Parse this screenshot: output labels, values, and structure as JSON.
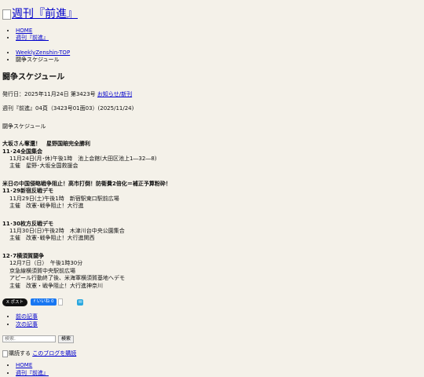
{
  "site": {
    "logo_text": "週刊『前進』"
  },
  "nav": {
    "items": [
      "HOME",
      "週刊『前進』"
    ]
  },
  "breadcrumb": {
    "link": "WeeklyZenshin-TOP",
    "current": "闘争スケジュール"
  },
  "article": {
    "title": "闘争スケジュール",
    "meta_prefix": "発行日：2025年11月24日 第3423号",
    "meta_link": "お知らせ/新刊",
    "issue_line": "週刊『前進』04頁（3423号01面03）(2025/11/24)",
    "section": "闘争スケジュール",
    "events": [
      {
        "head": [
          "大坂さん奪還！　星野国賠完全勝利",
          "11･24全国集会"
        ],
        "lines": [
          "11月24日(月･休)午後1時　池上会館(大田区池上1―32―8)",
          "主催　星野･大坂全国救援会"
        ]
      },
      {
        "head": [
          "米日の中国侵略戦争阻止！高市打倒！防衛費2倍化＝補正予算粉砕！",
          "11･29新宿反戦デモ"
        ],
        "lines": [
          "11月29日(土)午後1時　新宿駅東口駅前広場",
          "主催　改憲･戦争阻止！大行進"
        ]
      },
      {
        "head": [
          "11･30枚方反戦デモ"
        ],
        "lines": [
          "11月30日(日)午後2時　木津川台中央公園集合",
          "主催　改憲･戦争阻止！大行進関西"
        ]
      },
      {
        "head": [
          "12･7横須賀闘争"
        ],
        "lines": [
          "12月7日（日）　午後1時30分",
          "京急線横須賀中央駅前広場",
          "アピール行動終了後、米海軍横須賀基地へデモ",
          "主催　改憲・戦争阻止！大行進神奈川"
        ]
      }
    ]
  },
  "share": {
    "x_label": "X ポスト",
    "fb_label": "f いいね 0",
    "fb_count": " ",
    "mail_icon": "mail-icon"
  },
  "pager": {
    "prev": "前の記事",
    "next": "次の記事"
  },
  "search": {
    "placeholder": "検索.",
    "button": "検索"
  },
  "subscribe": {
    "text": "購読する",
    "link": "このブログを購読"
  },
  "footer_nav": {
    "items": [
      "HOME",
      "週刊『前進』"
    ]
  }
}
